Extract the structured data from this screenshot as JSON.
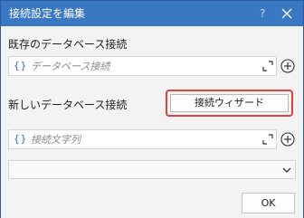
{
  "window": {
    "title": "接続設定を編集",
    "help_label": "?"
  },
  "existing_connection": {
    "label": "既存のデータベース接続",
    "placeholder": "データベース接続",
    "brace_icon": "{}"
  },
  "new_connection": {
    "label": "新しいデータベース接続",
    "wizard_button_label": "接続ウィザード"
  },
  "connection_string": {
    "placeholder": "接続文字列",
    "brace_icon": "{}"
  },
  "provider_dropdown": {
    "selected_value": ""
  },
  "footer": {
    "ok_label": "OK"
  },
  "colors": {
    "titlebar": "#3b78c4",
    "accent": "#2f6fc4",
    "highlight": "#e0433d"
  },
  "icons": [
    "close-icon",
    "expand-icon",
    "plus-circle-icon",
    "chevron-down-icon",
    "brace-icon"
  ]
}
